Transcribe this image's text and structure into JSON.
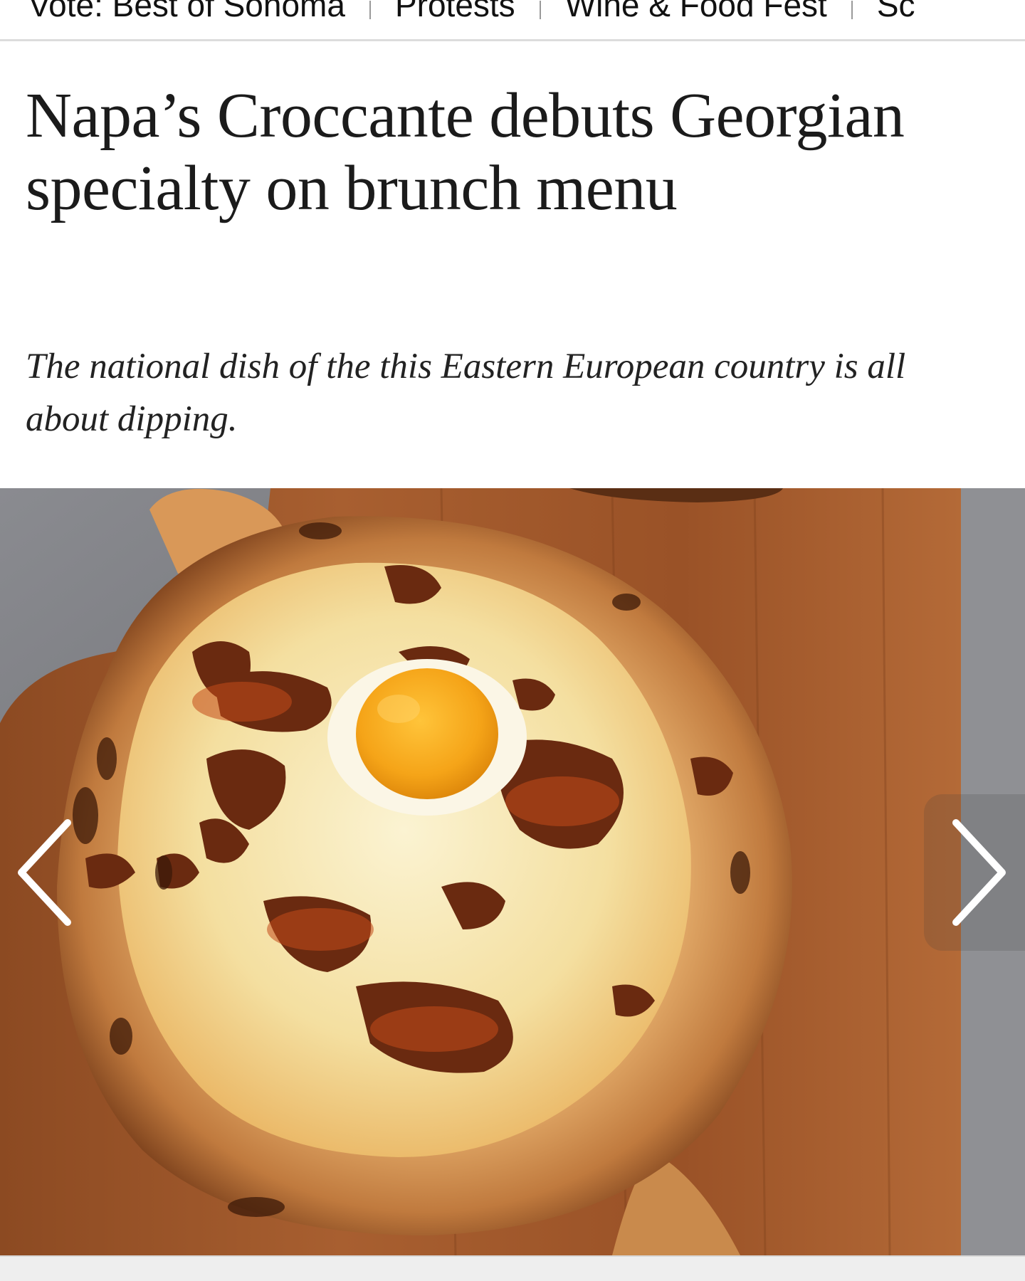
{
  "topnav": {
    "items": [
      {
        "label": "Vote: Best of Sonoma"
      },
      {
        "label": "Protests"
      },
      {
        "label": "Wine & Food Fest"
      },
      {
        "label": "Sc"
      }
    ]
  },
  "article": {
    "headline": "Napa’s Croccante debuts Georgian specialty on brunch menu",
    "dek": "The national dish of the this Eastern European country is all about dipping."
  },
  "gallery": {
    "prev_icon": "chevron-left-icon",
    "next_icon": "chevron-right-icon"
  },
  "colors": {
    "headline": "#1b1b1b",
    "nav_border": "#dcdcdc",
    "board": "#a0582c",
    "egg_yolk": "#f5a418",
    "crust": "#c98a4c"
  }
}
